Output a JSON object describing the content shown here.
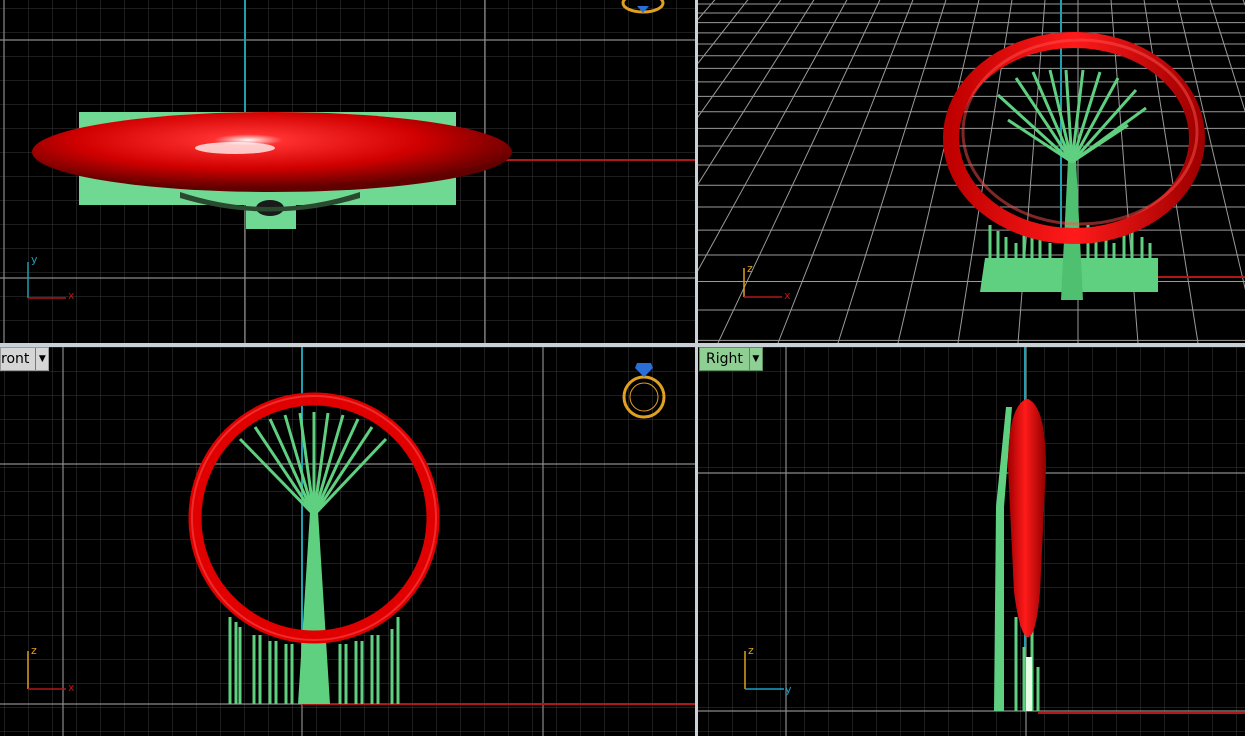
{
  "viewports": {
    "top": {
      "axis_labels": {
        "vertical": "y",
        "horizontal": "x"
      }
    },
    "perspective": {
      "axis_labels": {
        "vertical": "z",
        "horizontal": "x"
      }
    },
    "front": {
      "label": "ront",
      "axis_labels": {
        "vertical": "z",
        "horizontal": "x"
      }
    },
    "right": {
      "label": "Right",
      "axis_labels": {
        "vertical": "z",
        "horizontal": "y"
      }
    }
  },
  "icons": {
    "dropdown": "caret-down-icon",
    "view_indicator": "ring-icon"
  },
  "colors": {
    "background": "#000000",
    "grid_minor": "#3a3a3a",
    "grid_major": "#8a8a8a",
    "axis_red": "#b01818",
    "axis_cyan": "#1f9fb0",
    "ring_red": "#e00000",
    "support_green": "#5fcf80",
    "label_z": "#e0a020",
    "label_y_blue": "#18a0c8",
    "tab_active_green": "#8fcf93"
  }
}
